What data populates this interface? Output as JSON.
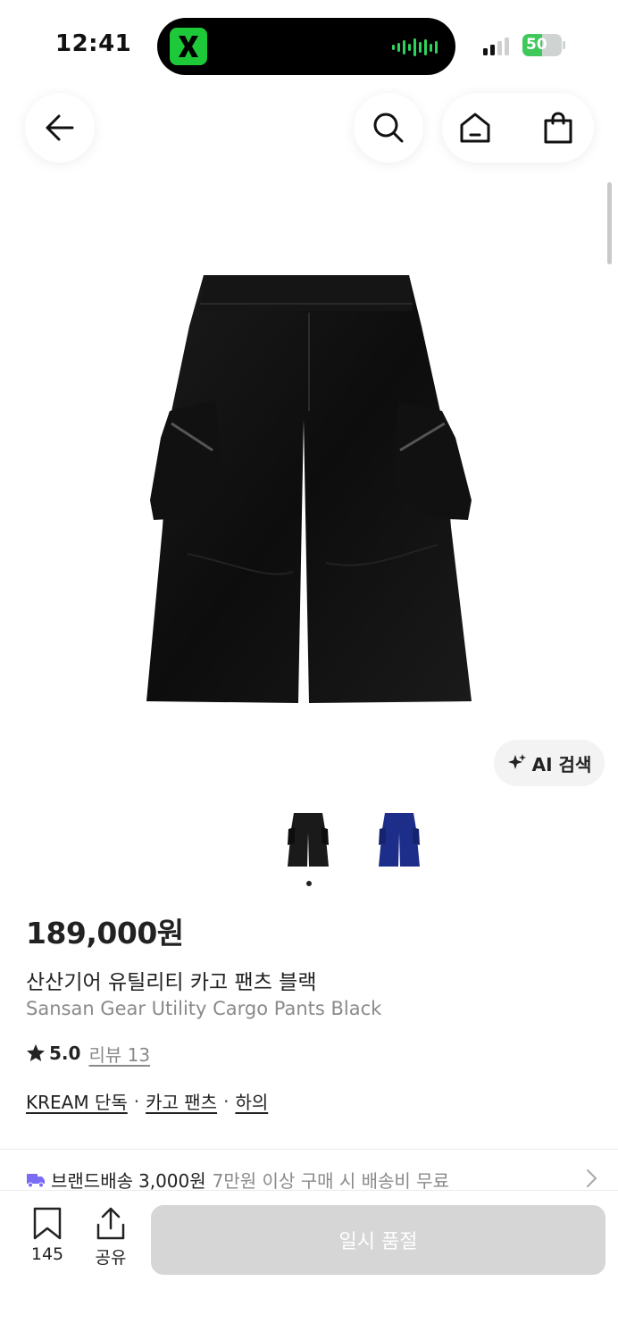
{
  "status_bar": {
    "time": "12:41",
    "battery": "50",
    "battery_level": 0.5
  },
  "nav": {
    "back_icon": "arrow-left-icon",
    "search_icon": "search-icon",
    "home_icon": "home-icon",
    "cart_icon": "shopping-bag-icon"
  },
  "product": {
    "ai_search_label": "AI 검색",
    "thumbnails": [
      {
        "color": "#1a1a1a",
        "label": "black"
      },
      {
        "color": "#1d2e8a",
        "label": "navy blue"
      }
    ],
    "selected_thumbnail_index": 0,
    "price": "189,000원",
    "name_ko": "산산기어 유틸리티 카고 팬츠 블랙",
    "name_en": "Sansan Gear Utility Cargo Pants Black",
    "rating": "5.0",
    "review_text": "리뷰 13",
    "categories": [
      "KREAM 단독",
      "카고 팬츠",
      "하의"
    ],
    "category_separator": "·"
  },
  "delivery": {
    "label": "브랜드배송",
    "fee": "3,000원",
    "note": "7만원 이상 구매 시 배송비 무료",
    "accent": "#7b6cf6"
  },
  "bottom_bar": {
    "bookmark_count": "145",
    "share_label": "공유",
    "buy_label": "일시 품절"
  },
  "colors": {
    "island_app": "#1ec939",
    "battery_fill": "#3ec95a",
    "buy_disabled": "#d6d6d6"
  }
}
